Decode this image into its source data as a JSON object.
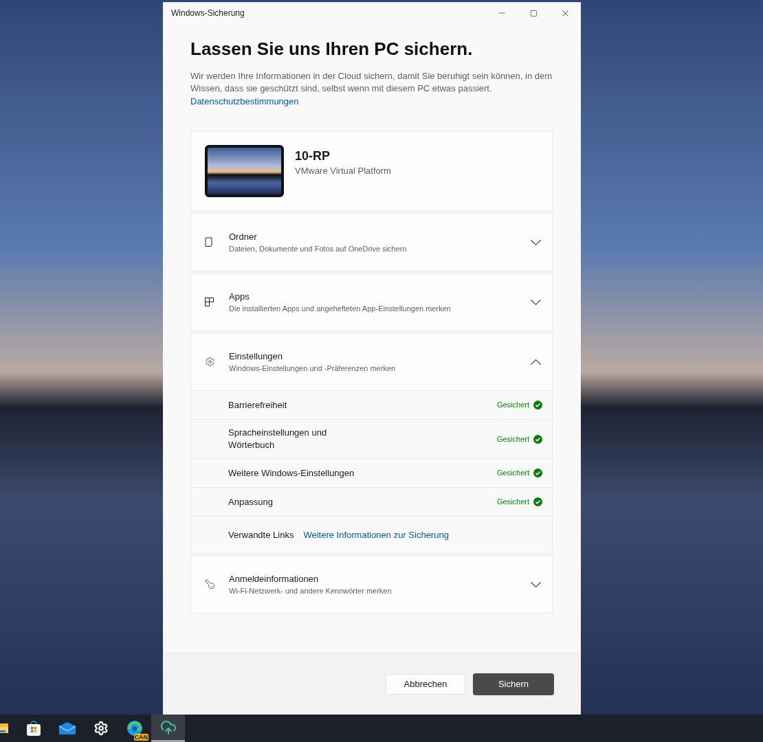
{
  "window": {
    "title": "Windows-Sicherung"
  },
  "heading": "Lassen Sie uns Ihren PC sichern.",
  "description": "Wir werden Ihre Informationen in der Cloud sichern, damit Sie beruhigt sein können, in dem Wissen, dass sie geschützt sind, selbst wenn mit diesem PC etwas passiert.",
  "privacy_link": "Datenschutzbestimmungen",
  "device": {
    "name": "10-RP",
    "model": "VMware Virtual Platform"
  },
  "sections": [
    {
      "kind": "folders",
      "title": "Ordner",
      "subtitle": "Dateien, Dokumente und Fotos auf OneDrive sichern",
      "expanded": false
    },
    {
      "kind": "apps",
      "title": "Apps",
      "subtitle": "Die installierten Apps und angehefteten App-Einstellungen merken",
      "expanded": false
    },
    {
      "kind": "settings",
      "title": "Einstellungen",
      "subtitle": "Windows-Einstellungen und -Präferenzen merken",
      "expanded": true,
      "items": [
        {
          "label": "Barrierefreiheit",
          "status": "Gesichert",
          "saved": true
        },
        {
          "label": "Spracheinstellungen und Wörterbuch",
          "status": "Gesichert",
          "saved": true
        },
        {
          "label": "Weitere Windows-Einstellungen",
          "status": "Gesichert",
          "saved": true
        },
        {
          "label": "Anpassung",
          "status": "Gesichert",
          "saved": true
        }
      ],
      "related": {
        "label": "Verwandte Links",
        "link": "Weitere Informationen zur Sicherung"
      }
    },
    {
      "kind": "credentials",
      "title": "Anmeldeinformationen",
      "subtitle": "Wi-Fi-Netzwerk- und andere Kennwörter merken",
      "expanded": false
    }
  ],
  "buttons": [
    {
      "label": "Abbrechen",
      "kind": "secondary"
    },
    {
      "label": "Sichern",
      "kind": "primary"
    }
  ],
  "taskbar": [
    {
      "kind": "explorer",
      "selected": false
    },
    {
      "kind": "store",
      "selected": false
    },
    {
      "kind": "mail",
      "selected": false
    },
    {
      "kind": "settings",
      "selected": false
    },
    {
      "kind": "edge",
      "selected": false,
      "badge": "CAN"
    },
    {
      "kind": "backup",
      "selected": true
    }
  ]
}
